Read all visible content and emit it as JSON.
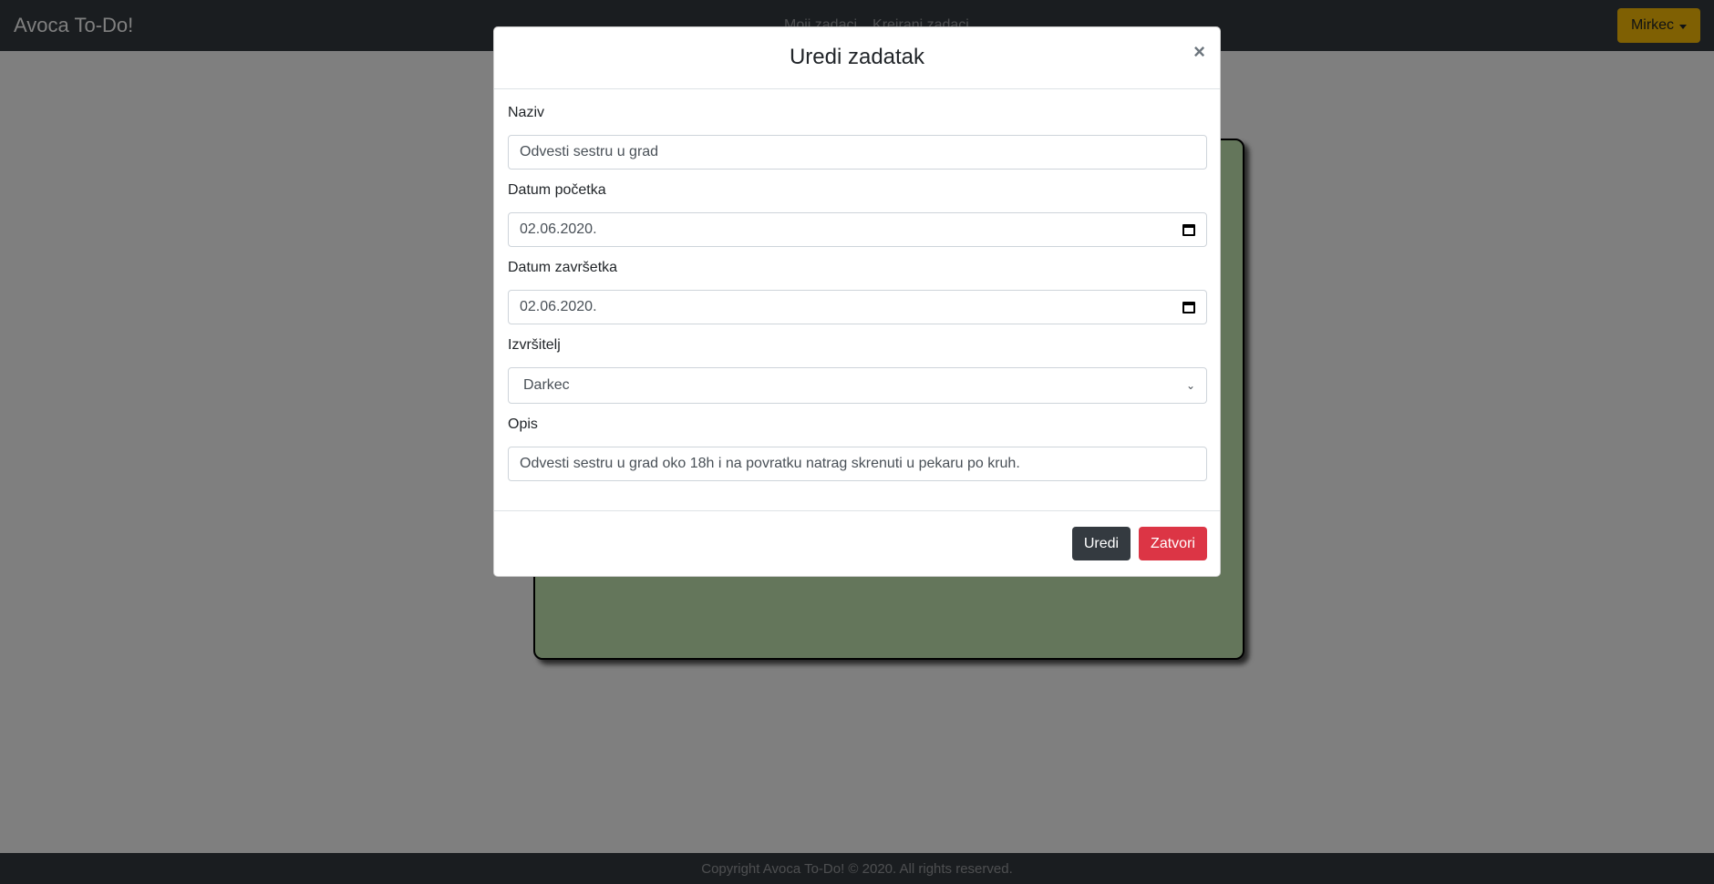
{
  "navbar": {
    "brand": "Avoca To-Do!",
    "links": [
      "Moji zadaci",
      "Kreirani zadaci"
    ],
    "user_button": "Mirkec"
  },
  "footer": {
    "text": "Copyright Avoca To-Do! © 2020. All rights reserved."
  },
  "modal": {
    "title": "Uredi zadatak",
    "close_symbol": "×",
    "fields": {
      "name": {
        "label": "Naziv",
        "value": "Odvesti sestru u grad"
      },
      "start_date": {
        "label": "Datum početka",
        "value": "02.06.2020."
      },
      "end_date": {
        "label": "Datum završetka",
        "value": "02.06.2020."
      },
      "assignee": {
        "label": "Izvršitelj",
        "value": "Darkec"
      },
      "description": {
        "label": "Opis",
        "value": "Odvesti sestru u grad oko 18h i na povratku natrag skrenuti u pekaru po kruh."
      }
    },
    "buttons": {
      "edit": "Uredi",
      "close": "Zatvori"
    }
  },
  "colors": {
    "navbar": "#343a40",
    "user_button": "#ffc107",
    "task_card": "#c8ecb6",
    "edit_button": "#343a40",
    "close_button": "#dc3545"
  },
  "icons": {
    "date_picker": "calendar-icon",
    "select": "chevron-down-icon",
    "dropdown": "caret-down-icon"
  }
}
